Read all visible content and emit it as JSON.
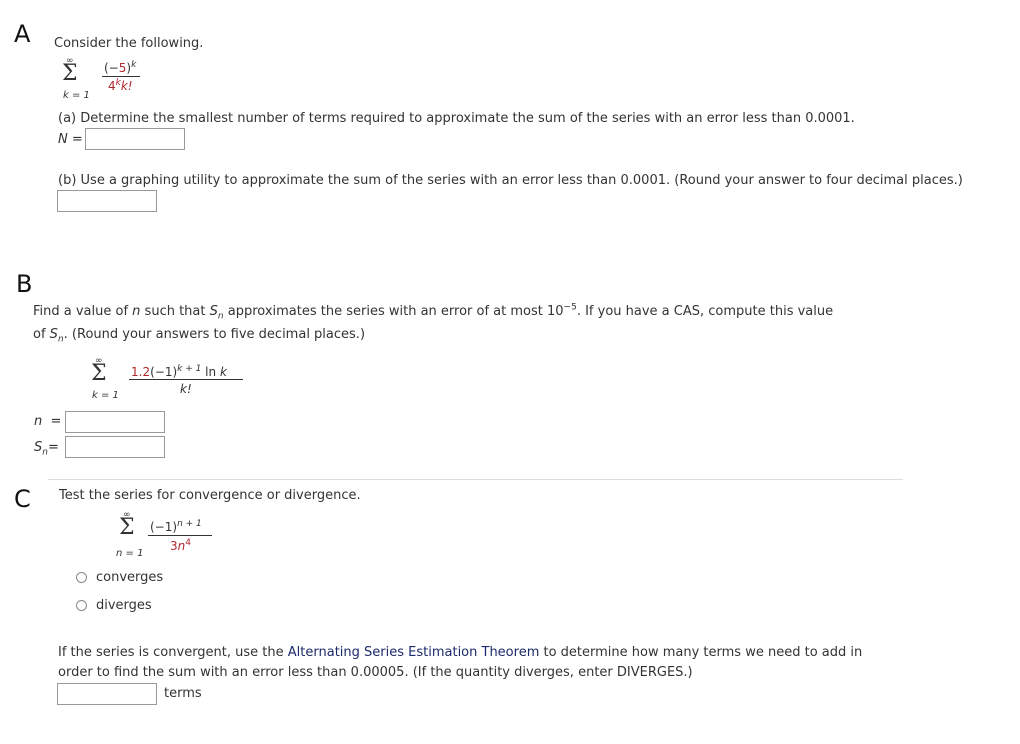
{
  "sections": {
    "A": {
      "letter": "A",
      "intro": "Consider the following.",
      "series": {
        "sigma": "Σ",
        "upper": "∞",
        "lower": "k = 1",
        "numerator_base": "(−",
        "numerator_num": "5",
        "numerator_close": ")",
        "numerator_exp": "k",
        "denominator_num": "4",
        "denominator_exp": "k",
        "denominator_rest": "k!"
      },
      "part_a": {
        "prompt": "(a) Determine the smallest number of terms required to approximate the sum of the series with an error less than 0.0001.",
        "label_var": "N",
        "label_eq": " =",
        "value": ""
      },
      "part_b": {
        "prompt": "(b) Use a graphing utility to approximate the sum of the series with an error less than 0.0001. (Round your answer to four decimal places.)",
        "value": ""
      }
    },
    "B": {
      "letter": "B",
      "line1_a": "Find a value of ",
      "line1_n": "n",
      "line1_b": " such that ",
      "line1_S": "S",
      "line1_sub": "n",
      "line1_c": " approximates the series with an error of at most 10",
      "line1_exp": "−5",
      "line1_d": ". If you have a CAS, compute this value",
      "line2_a": "of ",
      "line2_S": "S",
      "line2_sub": "n",
      "line2_b": ". (Round your answers to five decimal places.)",
      "series": {
        "sigma": "Σ",
        "upper": "∞",
        "lower": "k = 1",
        "numerator_coef": "1.2",
        "numerator_rest": "(−1)",
        "numerator_exp": "k + 1",
        "numerator_ln": " ln ",
        "numerator_k": "k",
        "denominator": "k!"
      },
      "n_label": "n",
      "n_eq": "=",
      "n_value": "",
      "sn_label": "S",
      "sn_sub": "n",
      "sn_eq": "=",
      "sn_value": ""
    },
    "C": {
      "letter": "C",
      "intro": "Test the series for convergence or divergence.",
      "series": {
        "sigma": "Σ",
        "upper": "∞",
        "lower": "n = 1",
        "numerator": "(−1)",
        "numerator_exp": "n + 1",
        "denominator_coef": "3",
        "denominator_var": "n",
        "denominator_exp": "4"
      },
      "options": [
        {
          "label": "converges",
          "selected": false
        },
        {
          "label": "diverges",
          "selected": false
        }
      ],
      "follow_a": "If the series is convergent, use the ",
      "follow_link": "Alternating Series Estimation Theorem",
      "follow_b": " to determine how many terms we need to add in",
      "follow_line2": "order to find the sum with an error less than 0.00005. (If the quantity diverges, enter DIVERGES.)",
      "terms_value": "",
      "terms_label": "terms"
    }
  }
}
